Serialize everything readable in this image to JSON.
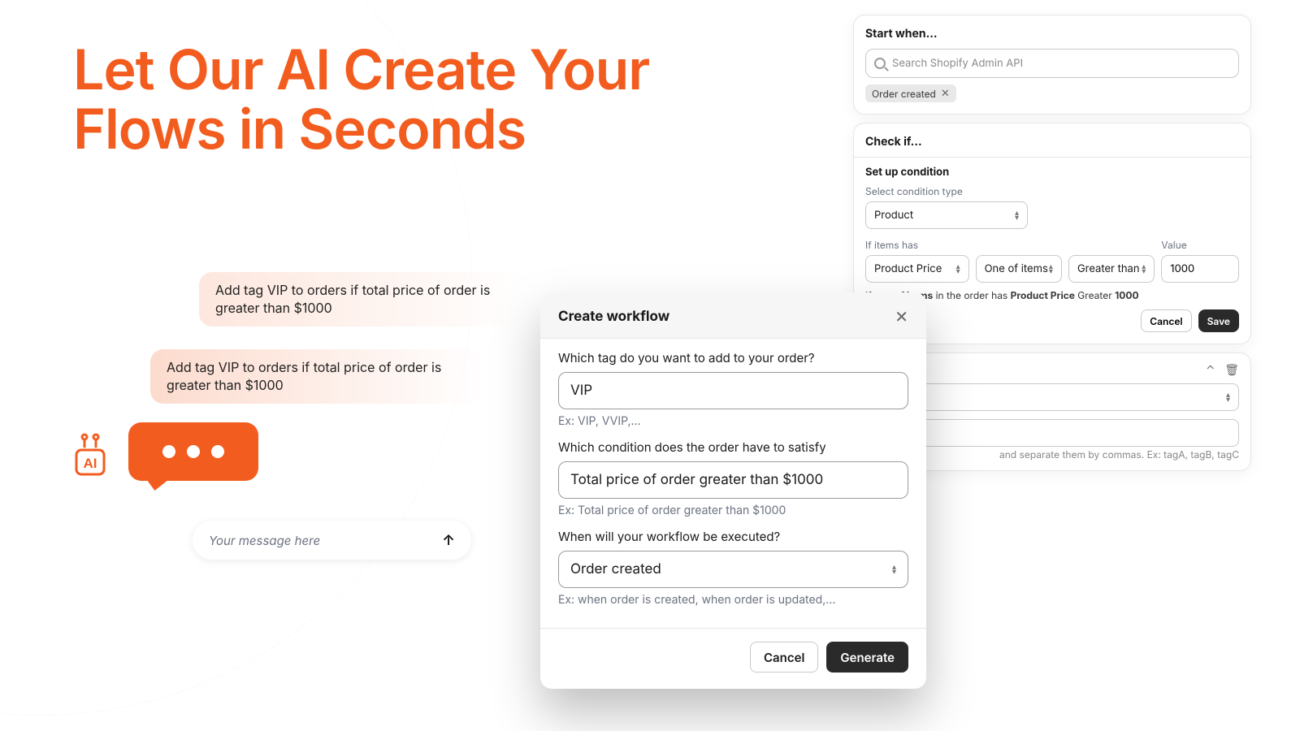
{
  "headline_line1": "Let Our AI Create Your",
  "headline_line2": "Flows in Seconds",
  "chat": {
    "msg1": "Add tag VIP to orders if total price of order is greater than $1000",
    "msg2": "Add tag VIP to orders if total price of order is greater than $1000",
    "input_placeholder": "Your message here"
  },
  "modal": {
    "title": "Create workflow",
    "q_tag": "Which tag do you want to add to your order?",
    "v_tag": "VIP",
    "h_tag": "Ex: VIP, VVIP,...",
    "q_cond": "Which condition does the order have to satisfy",
    "v_cond": "Total price of order greater than $1000",
    "h_cond": "Ex: Total price of order greater than $1000",
    "q_when": "When will your workflow be executed?",
    "v_when": "Order created",
    "h_when": "Ex: when order is created, when order is updated,...",
    "cancel": "Cancel",
    "generate": "Generate"
  },
  "builder": {
    "start": {
      "title": "Start when...",
      "search_ph": "Search Shopify Admin API",
      "chip": "Order created"
    },
    "check": {
      "title": "Check if...",
      "setup": "Set up condition",
      "sel_type_label": "Select condition type",
      "sel_type": "Product",
      "items_label": "If items has",
      "items_field": "Product Price",
      "items_scope": "One of items",
      "items_op": "Greater than",
      "value_label": "Value",
      "value": "1000",
      "summary_pre": "If ",
      "summary_b1": "one of items",
      "summary_mid": " in the order has ",
      "summary_b2": "Product Price",
      "summary_after": " Greater ",
      "summary_b3": "1000",
      "cancel": "Cancel",
      "save": "Save"
    },
    "third": {
      "tags_hint": " and separate them by commas. Ex: tagA, tagB, tagC"
    }
  }
}
